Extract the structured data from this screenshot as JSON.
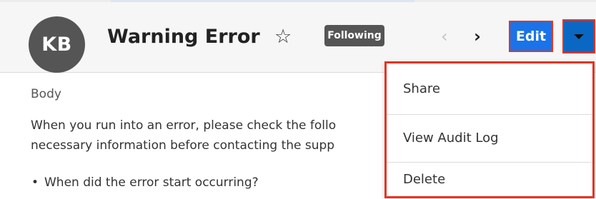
{
  "record": {
    "avatar_initials": "KB",
    "title": "Warning Error",
    "following_label": "Following",
    "edit_label": "Edit"
  },
  "icons": {
    "star": "star-outline-icon",
    "prev": "chevron-left-icon",
    "next": "chevron-right-icon",
    "caret": "caret-down-icon"
  },
  "content": {
    "field_label": "Body",
    "paragraph_line1": "When you run into an error, please check the follo",
    "paragraph_line2": "necessary information before contacting the supp",
    "bullet1": "When did the error start occurring?"
  },
  "dropdown": {
    "items": [
      {
        "label": "Share"
      },
      {
        "label": "View Audit Log"
      },
      {
        "label": "Delete"
      }
    ]
  },
  "colors": {
    "edit_button": "#1a73e8",
    "caret_button": "#0a68c4",
    "highlight_border": "#e53423",
    "avatar_bg": "#555555",
    "following_bg": "#555555"
  }
}
